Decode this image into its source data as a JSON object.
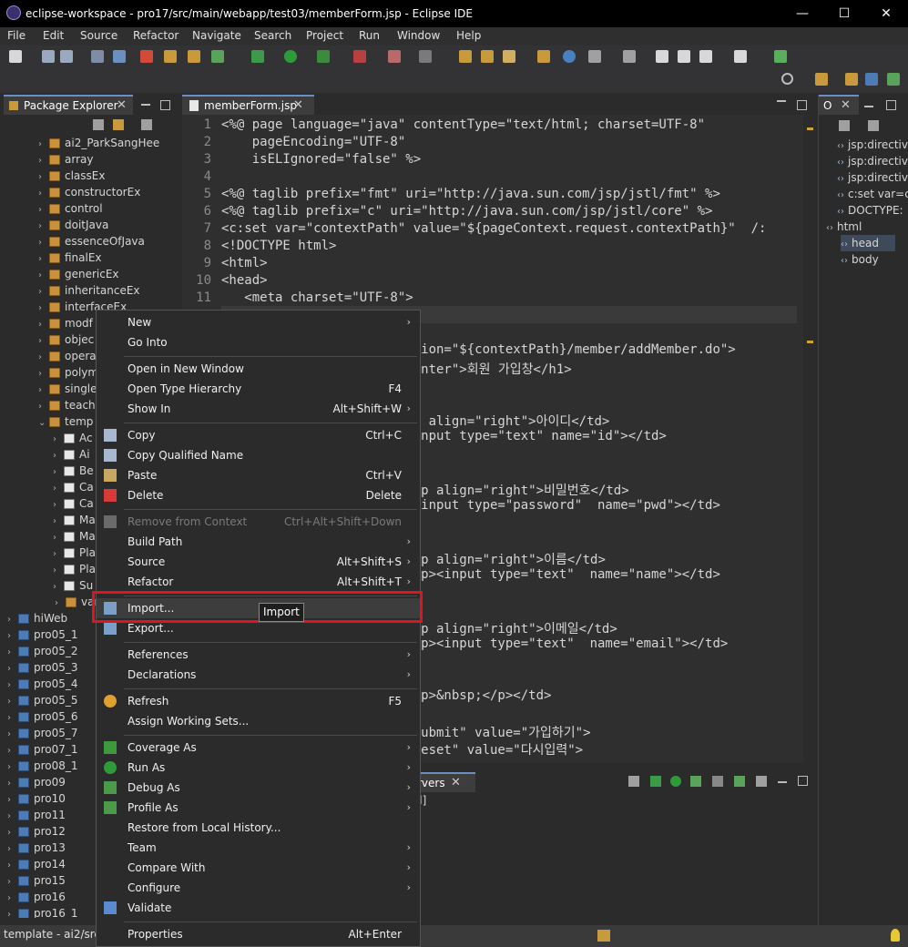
{
  "window": {
    "title": "eclipse-workspace - pro17/src/main/webapp/test03/memberForm.jsp - Eclipse IDE",
    "min": "—",
    "max": "☐",
    "close": "✕"
  },
  "menubar": [
    "File",
    "Edit",
    "Source",
    "Refactor",
    "Navigate",
    "Search",
    "Project",
    "Run",
    "Window",
    "Help"
  ],
  "package_explorer": {
    "tab_label": "Package Explorer",
    "tree": [
      {
        "label": "ai2_ParkSangHee",
        "kind": "pkg"
      },
      {
        "label": "array",
        "kind": "pkg"
      },
      {
        "label": "classEx",
        "kind": "pkg"
      },
      {
        "label": "constructorEx",
        "kind": "pkg"
      },
      {
        "label": "control",
        "kind": "pkg"
      },
      {
        "label": "doitJava",
        "kind": "pkg"
      },
      {
        "label": "essenceOfJava",
        "kind": "pkg"
      },
      {
        "label": "finalEx",
        "kind": "pkg"
      },
      {
        "label": "genericEx",
        "kind": "pkg"
      },
      {
        "label": "inheritanceEx",
        "kind": "pkg"
      },
      {
        "label": "interfaceEx",
        "kind": "pkg"
      },
      {
        "label": "modf",
        "kind": "pkg"
      },
      {
        "label": "objec",
        "kind": "pkg"
      },
      {
        "label": "opera",
        "kind": "pkg"
      },
      {
        "label": "polym",
        "kind": "pkg"
      },
      {
        "label": "single",
        "kind": "pkg"
      },
      {
        "label": "teach",
        "kind": "pkg"
      },
      {
        "label": "temp",
        "kind": "pkg"
      },
      {
        "label": "Ac",
        "kind": "file"
      },
      {
        "label": "Ai",
        "kind": "file"
      },
      {
        "label": "Be",
        "kind": "file"
      },
      {
        "label": "Ca",
        "kind": "file"
      },
      {
        "label": "Ca",
        "kind": "file"
      },
      {
        "label": "Ma",
        "kind": "file"
      },
      {
        "label": "Ma",
        "kind": "file"
      },
      {
        "label": "Pla",
        "kind": "file"
      },
      {
        "label": "Pla",
        "kind": "file"
      },
      {
        "label": "Su",
        "kind": "file"
      },
      {
        "label": "varia",
        "kind": "pkg"
      },
      {
        "label": "hiWeb",
        "kind": "proj"
      },
      {
        "label": "pro05_1",
        "kind": "proj"
      },
      {
        "label": "pro05_2",
        "kind": "proj"
      },
      {
        "label": "pro05_3",
        "kind": "proj"
      },
      {
        "label": "pro05_4",
        "kind": "proj"
      },
      {
        "label": "pro05_5",
        "kind": "proj"
      },
      {
        "label": "pro05_6",
        "kind": "proj"
      },
      {
        "label": "pro05_7",
        "kind": "proj"
      },
      {
        "label": "pro07_1",
        "kind": "proj"
      },
      {
        "label": "pro08_1",
        "kind": "proj"
      },
      {
        "label": "pro09",
        "kind": "proj"
      },
      {
        "label": "pro10",
        "kind": "proj"
      },
      {
        "label": "pro11",
        "kind": "proj"
      },
      {
        "label": "pro12",
        "kind": "proj"
      },
      {
        "label": "pro13",
        "kind": "proj"
      },
      {
        "label": "pro14",
        "kind": "proj"
      },
      {
        "label": "pro15",
        "kind": "proj"
      },
      {
        "label": "pro16",
        "kind": "proj"
      },
      {
        "label": "pro16_1",
        "kind": "proj"
      }
    ]
  },
  "editor": {
    "tab_label": "memberForm.jsp",
    "lines": [
      {
        "n": "1",
        "t": "<%@ page language=\"java\" contentType=\"text/html; charset=UTF-8\""
      },
      {
        "n": "2",
        "t": "    pageEncoding=\"UTF-8\""
      },
      {
        "n": "3",
        "t": "    isELIgnored=\"false\" %>"
      },
      {
        "n": "4",
        "t": ""
      },
      {
        "n": "5",
        "t": "<%@ taglib prefix=\"fmt\" uri=\"http://java.sun.com/jsp/jstl/fmt\" %>"
      },
      {
        "n": "6",
        "t": "<%@ taglib prefix=\"c\" uri=\"http://java.sun.com/jsp/jstl/core\" %>"
      },
      {
        "n": "7",
        "t": "<c:set var=\"contextPath\" value=\"${pageContext.request.contextPath}\"  /:"
      },
      {
        "n": "8",
        "t": "<!DOCTYPE html>"
      },
      {
        "n": "9",
        "t": "<html>"
      },
      {
        "n": "10",
        "t": "<head>"
      },
      {
        "n": "11",
        "t": "   <meta charset=\"UTF-8\">"
      },
      {
        "n": "",
        "t": "                        >"
      },
      {
        "n": "",
        "t": ""
      },
      {
        "n": "",
        "t": "                         tion=\"${contextPath}/member/addMember.do\">"
      },
      {
        "n": "",
        "t": "                         enter\">회원 가입창</h1>"
      },
      {
        "n": "",
        "t": ""
      },
      {
        "n": "",
        "t": ""
      },
      {
        "n": "",
        "t": "                         p align=\"right\">아이디</td>"
      },
      {
        "n": "",
        "t": "                         input type=\"text\" name=\"id\"></td>"
      },
      {
        "n": "",
        "t": ""
      },
      {
        "n": "",
        "t": ""
      },
      {
        "n": "",
        "t": "                         <p align=\"right\">비밀번호</td>"
      },
      {
        "n": "",
        "t": "                         <input type=\"password\"  name=\"pwd\"></td>"
      },
      {
        "n": "",
        "t": ""
      },
      {
        "n": "",
        "t": ""
      },
      {
        "n": "",
        "t": "                         <p align=\"right\">이름</td>"
      },
      {
        "n": "",
        "t": "                         <p><input type=\"text\"  name=\"name\"></td>"
      },
      {
        "n": "",
        "t": ""
      },
      {
        "n": "",
        "t": ""
      },
      {
        "n": "",
        "t": "                         <p align=\"right\">이메일</td>"
      },
      {
        "n": "",
        "t": "                         <p><input type=\"text\"  name=\"email\"></td>"
      },
      {
        "n": "",
        "t": ""
      },
      {
        "n": "",
        "t": ""
      },
      {
        "n": "",
        "t": "                         <p>&nbsp;</p></td>"
      },
      {
        "n": "",
        "t": ""
      },
      {
        "n": "",
        "t": "                         submit\" value=\"가입하기\">"
      },
      {
        "n": "",
        "t": "                         reset\" value=\"다시입력\">"
      }
    ]
  },
  "outline": {
    "tab_label": "O",
    "items": [
      "jsp:directiv",
      "jsp:directiv",
      "jsp:directiv",
      "c:set var=c",
      "DOCTYPE:",
      "html",
      "head",
      "body"
    ]
  },
  "servers": {
    "tab_label": "rvers",
    "line": "d]"
  },
  "status_bar": {
    "text": "template - ai2/src"
  },
  "tooltip": "Import",
  "context_menu": {
    "items": [
      {
        "label": "New",
        "sub": true
      },
      {
        "label": "Go Into"
      },
      {
        "sep": true
      },
      {
        "label": "Open in New Window"
      },
      {
        "label": "Open Type Hierarchy",
        "acc": "F4"
      },
      {
        "label": "Show In",
        "acc": "Alt+Shift+W",
        "sub": true
      },
      {
        "sep": true
      },
      {
        "label": "Copy",
        "acc": "Ctrl+C",
        "icon": "copy-icon"
      },
      {
        "label": "Copy Qualified Name",
        "icon": "copy-qualified-icon"
      },
      {
        "label": "Paste",
        "acc": "Ctrl+V",
        "icon": "paste-icon"
      },
      {
        "label": "Delete",
        "acc": "Delete",
        "icon": "delete-icon"
      },
      {
        "sep": true
      },
      {
        "label": "Remove from Context",
        "acc": "Ctrl+Alt+Shift+Down",
        "disabled": true,
        "icon": "remove-context-icon"
      },
      {
        "label": "Build Path",
        "sub": true
      },
      {
        "label": "Source",
        "acc": "Alt+Shift+S",
        "sub": true
      },
      {
        "label": "Refactor",
        "acc": "Alt+Shift+T",
        "sub": true
      },
      {
        "sep": true
      },
      {
        "label": "Import...",
        "icon": "import-icon",
        "highlight": true
      },
      {
        "label": "Export...",
        "icon": "export-icon"
      },
      {
        "sep": true
      },
      {
        "label": "References",
        "sub": true
      },
      {
        "label": "Declarations",
        "sub": true
      },
      {
        "sep": true
      },
      {
        "label": "Refresh",
        "acc": "F5",
        "icon": "refresh-icon"
      },
      {
        "label": "Assign Working Sets..."
      },
      {
        "sep": true
      },
      {
        "label": "Coverage As",
        "sub": true,
        "icon": "coverage-icon"
      },
      {
        "label": "Run As",
        "sub": true,
        "icon": "run-icon"
      },
      {
        "label": "Debug As",
        "sub": true,
        "icon": "debug-icon"
      },
      {
        "label": "Profile As",
        "sub": true,
        "icon": "profile-icon"
      },
      {
        "label": "Restore from Local History..."
      },
      {
        "label": "Team",
        "sub": true
      },
      {
        "label": "Compare With",
        "sub": true
      },
      {
        "label": "Configure",
        "sub": true
      },
      {
        "label": "Validate",
        "icon": "validate-check-icon"
      },
      {
        "sep": true
      },
      {
        "label": "Properties",
        "acc": "Alt+Enter"
      }
    ]
  },
  "colors": {
    "highlight_box": "#e0141e",
    "accent_menu": "#3d3d3d"
  }
}
